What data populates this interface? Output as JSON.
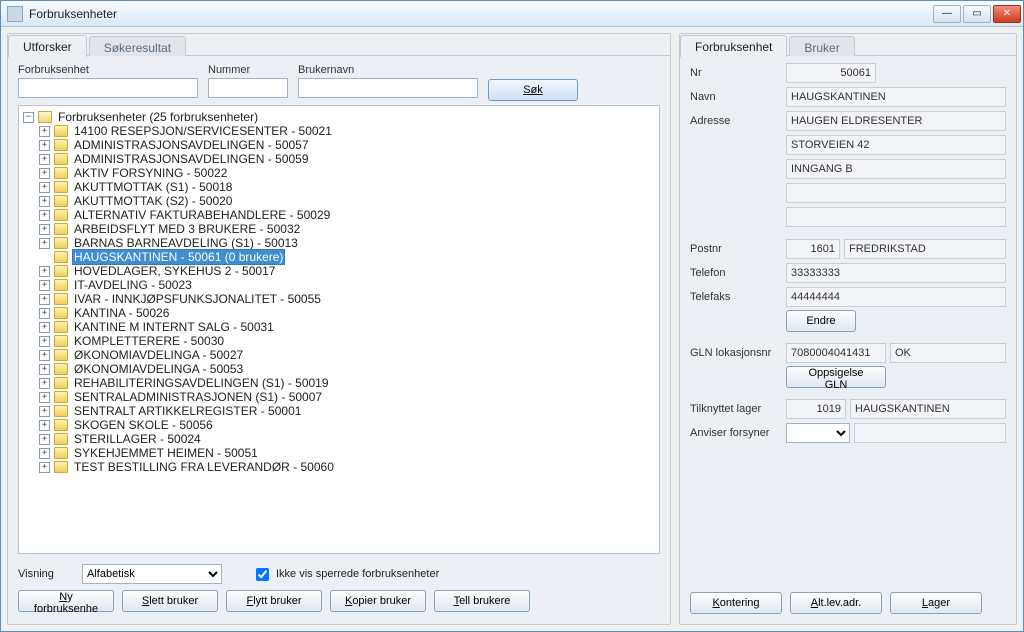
{
  "window": {
    "title": "Forbruksenheter"
  },
  "left": {
    "tabs": {
      "explorer": "Utforsker",
      "search_result": "Søkeresultat"
    },
    "filter_labels": {
      "forbruksenhet": "Forbruksenhet",
      "nummer": "Nummer",
      "brukernavn": "Brukernavn"
    },
    "search_btn": "Søk",
    "tree_root": "Forbruksenheter (25 forbruksenheter)",
    "tree_items": [
      "14100 RESEPSJON/SERVICESENTER - 50021",
      "ADMINISTRASJONSAVDELINGEN - 50057",
      "ADMINISTRASJONSAVDELINGEN - 50059",
      "AKTIV FORSYNING - 50022",
      "AKUTTMOTTAK (S1) - 50018",
      "AKUTTMOTTAK (S2) - 50020",
      "ALTERNATIV FAKTURABEHANDLERE - 50029",
      "ARBEIDSFLYT MED 3 BRUKERE - 50032",
      "BARNAS BARNEAVDELING (S1) - 50013",
      "HAUGSKANTINEN - 50061 (0 brukere)",
      "HOVEDLAGER, SYKEHUS 2 - 50017",
      "IT-AVDELING - 50023",
      "IVAR - INNKJØPSFUNKSJONALITET - 50055",
      "KANTINA - 50026",
      "KANTINE M INTERNT SALG - 50031",
      "KOMPLETTERERE - 50030",
      "ØKONOMIAVDELINGA - 50027",
      "ØKONOMIAVDELINGA - 50053",
      "REHABILITERINGSAVDELINGEN (S1) - 50019",
      "SENTRALADMINISTRASJONEN (S1) - 50007",
      "SENTRALT ARTIKKELREGISTER - 50001",
      "SKOGEN SKOLE - 50056",
      "STERILLAGER - 50024",
      "SYKEHJEMMET HEIMEN - 50051",
      "TEST BESTILLING FRA LEVERANDØR - 50060"
    ],
    "selected_index": 9,
    "view_label": "Visning",
    "view_value": "Alfabetisk",
    "hide_locked_label": "Ikke vis sperrede forbruksenheter",
    "buttons": {
      "ny": "Ny forbruksenhet",
      "slett": "Slett bruker",
      "flytt": "Flytt bruker",
      "kopier": "Kopier bruker",
      "tell": "Tell brukere"
    }
  },
  "right": {
    "tabs": {
      "forbruksenhet": "Forbruksenhet",
      "bruker": "Bruker"
    },
    "labels": {
      "nr": "Nr",
      "navn": "Navn",
      "adresse": "Adresse",
      "postnr": "Postnr",
      "telefon": "Telefon",
      "telefaks": "Telefaks",
      "endre": "Endre",
      "gln": "GLN lokasjonsnr",
      "oppsigelse": "Oppsigelse GLN",
      "lager": "Tilknyttet lager",
      "anviser": "Anviser forsyner"
    },
    "values": {
      "nr": "50061",
      "navn": "HAUGSKANTINEN",
      "adresse1": "HAUGEN ELDRESENTER",
      "adresse2": "STORVEIEN 42",
      "adresse3": "INNGANG B",
      "postnr": "1601",
      "poststed": "FREDRIKSTAD",
      "telefon": "33333333",
      "telefaks": "44444444",
      "gln": "7080004041431",
      "gln_status": "OK",
      "lager_nr": "1019",
      "lager_navn": "HAUGSKANTINEN"
    },
    "buttons": {
      "kontering": "Kontering",
      "altlev": "Alt.lev.adr.",
      "lager": "Lager"
    }
  }
}
